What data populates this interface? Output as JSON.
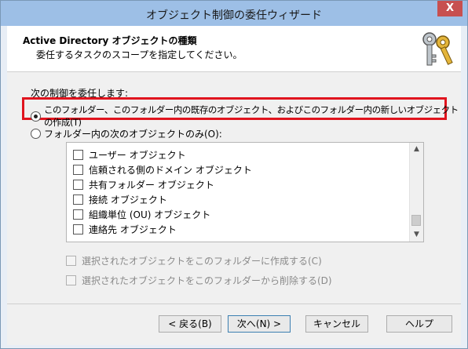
{
  "window": {
    "title": "オブジェクト制御の委任ウィザード",
    "close_label": "X"
  },
  "header": {
    "title": "Active Directory オブジェクトの種類",
    "subtitle": "委任するタスクのスコープを指定してください。"
  },
  "delegate_label": "次の制御を委任します:",
  "options": {
    "all_objects": "このフォルダー、このフォルダー内の既存のオブジェクト、およびこのフォルダー内の新しいオブジェクトの作成(T)",
    "only_following": "フォルダー内の次のオブジェクトのみ(O):"
  },
  "object_list": [
    "ユーザー オブジェクト",
    "信頼される側のドメイン オブジェクト",
    "共有フォルダー オブジェクト",
    "接続 オブジェクト",
    "組織単位 (OU) オブジェクト",
    "連絡先 オブジェクト"
  ],
  "scroll": {
    "up": "▲",
    "down": "▼"
  },
  "create_option": "選択されたオブジェクトをこのフォルダーに作成する(C)",
  "delete_option": "選択されたオブジェクトをこのフォルダーから削除する(D)",
  "buttons": {
    "back": "< 戻る(B)",
    "next": "次へ(N) >",
    "cancel": "キャンセル",
    "help": "ヘルプ"
  }
}
